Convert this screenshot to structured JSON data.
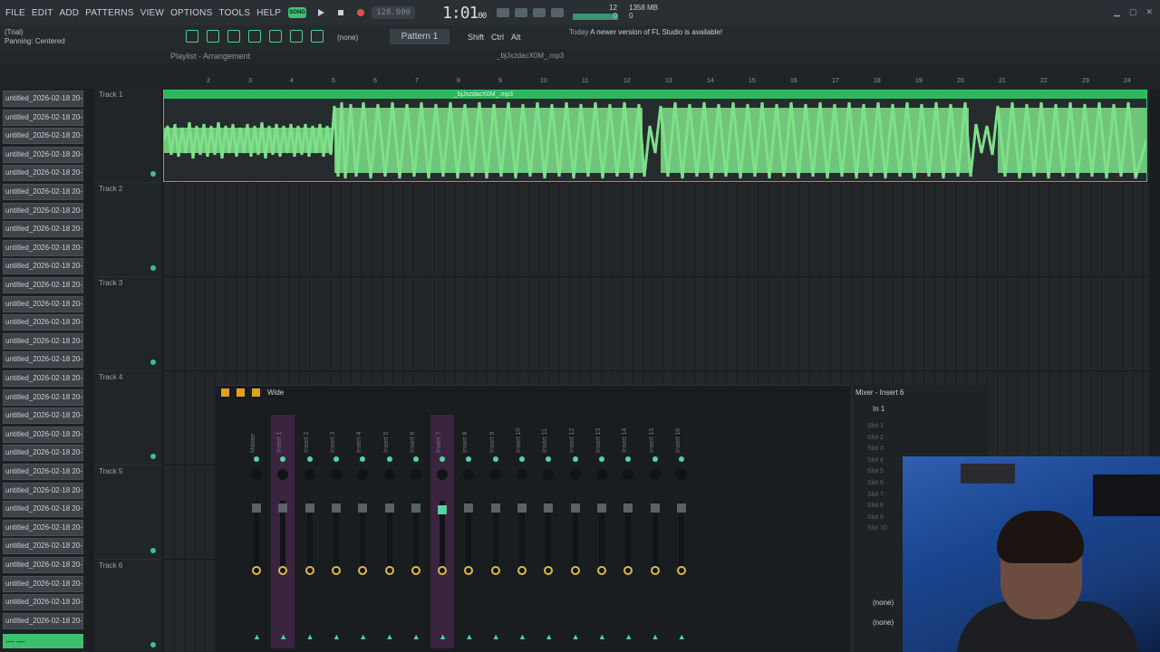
{
  "menu": [
    "FILE",
    "EDIT",
    "ADD",
    "PATTERNS",
    "VIEW",
    "OPTIONS",
    "TOOLS",
    "HELP"
  ],
  "song_mode": "SONG",
  "bpm": "128.000",
  "time_main": "1:01",
  "time_sub": "00",
  "cpu": "12",
  "cpu_val": "0",
  "mem": "1358 MB",
  "mem_val": "0",
  "trial": "(Trial)",
  "hint": "Panning: Centered",
  "pattern_none": "(none)",
  "pattern": "Pattern 1",
  "keys": [
    "Shift",
    "Ctrl",
    "Alt"
  ],
  "news_today": "Today",
  "news_text": "A newer version of FL Studio is available!",
  "playlist_title": "Playlist - Arrangement",
  "playlist_file": "_bjJxzdacX0M_.mp3",
  "clip_name": "_bjJxzdacX0M_.mp3",
  "ruler": [
    "2",
    "3",
    "4",
    "5",
    "6",
    "7",
    "8",
    "9",
    "10",
    "11",
    "12",
    "13",
    "14",
    "15",
    "16",
    "17",
    "18",
    "19",
    "20",
    "21",
    "22",
    "23",
    "24"
  ],
  "picker_items": [
    "untitled_2026-02-18 20-",
    "untitled_2026-02-18 20-",
    "untitled_2026-02-18 20-",
    "untitled_2026-02-18 20-",
    "untitled_2026-02-18 20-",
    "untitled_2026-02-18 20-",
    "untitled_2026-02-18 20-",
    "untitled_2026-02-18 20-",
    "untitled_2026-02-18 20-",
    "untitled_2026-02-18 20-",
    "untitled_2026-02-18 20-",
    "untitled_2026-02-18 20-",
    "untitled_2026-02-18 20-",
    "untitled_2026-02-18 20-",
    "untitled_2026-02-18 20-",
    "untitled_2026-02-18 20-",
    "untitled_2026-02-18 20-",
    "untitled_2026-02-18 20-",
    "untitled_2026-02-18 20-",
    "untitled_2026-02-18 20-",
    "untitled_2026-02-18 20-",
    "untitled_2026-02-18 20-",
    "untitled_2026-02-18 20-",
    "untitled_2026-02-18 20-",
    "untitled_2026-02-18 20-",
    "untitled_2026-02-18 20-",
    "untitled_2026-02-18 20-",
    "untitled_2026-02-18 20-",
    "untitled_2026-02-18 20-"
  ],
  "tracks": [
    "Track 1",
    "Track 2",
    "Track 3",
    "Track 4",
    "Track 5",
    "Track 6"
  ],
  "mixer_preset": "Wide",
  "mixer_strips": [
    "Master",
    "Insert 1",
    "Insert 2",
    "Insert 3",
    "Insert 4",
    "Insert 5",
    "Insert 6",
    "Insert 7",
    "Insert 8",
    "Insert 9",
    "Insert 10",
    "Insert 11",
    "Insert 12",
    "Insert 13",
    "Insert 14",
    "Insert 15",
    "Insert 16"
  ],
  "mixer_title": "Mixer - Insert 6",
  "mixer_in": "In 1",
  "slots": [
    "Slot 1",
    "Slot 2",
    "Slot 3",
    "Slot 4",
    "Slot 5",
    "Slot 6",
    "Slot 7",
    "Slot 8",
    "Slot 9",
    "Slot 10"
  ],
  "mixer_out1": "(none)",
  "mixer_out2": "(none)",
  "accent": "#3fc07a"
}
